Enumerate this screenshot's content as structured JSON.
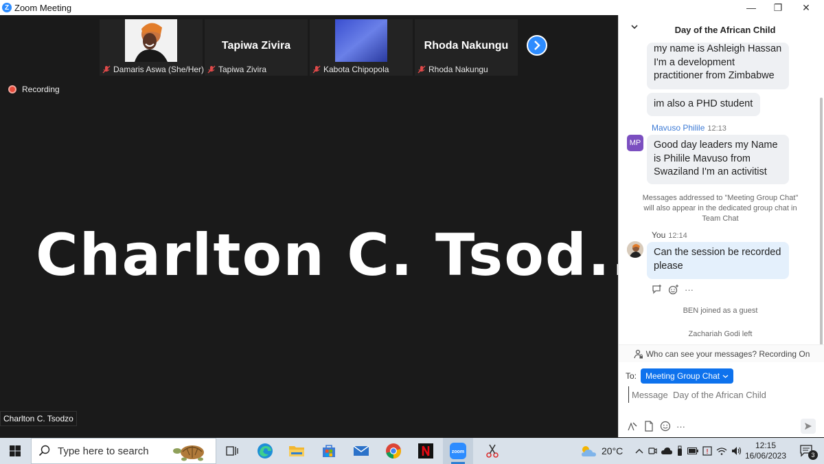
{
  "window": {
    "title": "Zoom Meeting",
    "logo_letter": "Z",
    "minimize_glyph": "—",
    "restore_glyph": "❐",
    "close_glyph": "✕"
  },
  "video": {
    "participants": [
      {
        "label": "Damaris Aswa (She/Her)",
        "display": "",
        "muted": true,
        "has_photo": true
      },
      {
        "label": "Tapiwa Zivira",
        "display": "Tapiwa Zivira",
        "muted": true,
        "has_photo": false
      },
      {
        "label": "Kabota Chipopola",
        "display": "",
        "muted": true,
        "has_photo": true
      },
      {
        "label": "Rhoda Nakungu",
        "display": "Rhoda Nakungu",
        "muted": true,
        "has_photo": false
      }
    ],
    "recording_label": "Recording",
    "active_speaker_big": "Charlton C. Tsod...",
    "active_speaker_label": "Charlton C. Tsodzo"
  },
  "chat": {
    "title": "Day of the African Child",
    "messages": [
      {
        "text_lines": [
          "my name is Ashleigh Hassan",
          "I'm a development",
          "practitioner from Zimbabwe"
        ]
      },
      {
        "text_lines": [
          "im also a PHD student"
        ]
      },
      {
        "sender": "Mavuso Philile",
        "time": "12:13",
        "avatar": "MP",
        "text_lines": [
          "Good day leaders my Name",
          "is Philile Mavuso from",
          "Swaziland I'm an activitist"
        ]
      },
      {
        "sender": "You",
        "time": "12:14",
        "text_lines": [
          "Can the session be recorded",
          "please"
        ]
      }
    ],
    "system_notice": [
      "Messages addressed to \"Meeting Group Chat\"",
      "will also appear in the dedicated group chat in",
      "Team Chat"
    ],
    "events": [
      "BEN joined as a guest",
      "Zachariah Godi left"
    ],
    "visibility_notice": "Who can see your messages? Recording On",
    "to_label": "To:",
    "to_target": "Meeting Group Chat",
    "input_placeholder": "Message  Day of the African Child",
    "more_glyph": "···"
  },
  "taskbar": {
    "search_placeholder": "Type here to search",
    "weather": "20°C",
    "time": "12:15",
    "date": "16/06/2023",
    "notification_count": "3"
  },
  "colors": {
    "zoom_blue": "#2d8cff",
    "chat_link": "#3d7bd6",
    "to_button": "#0e72ed",
    "avatar_mp": "#7b4fc0",
    "recording_red": "#e74c3c"
  }
}
